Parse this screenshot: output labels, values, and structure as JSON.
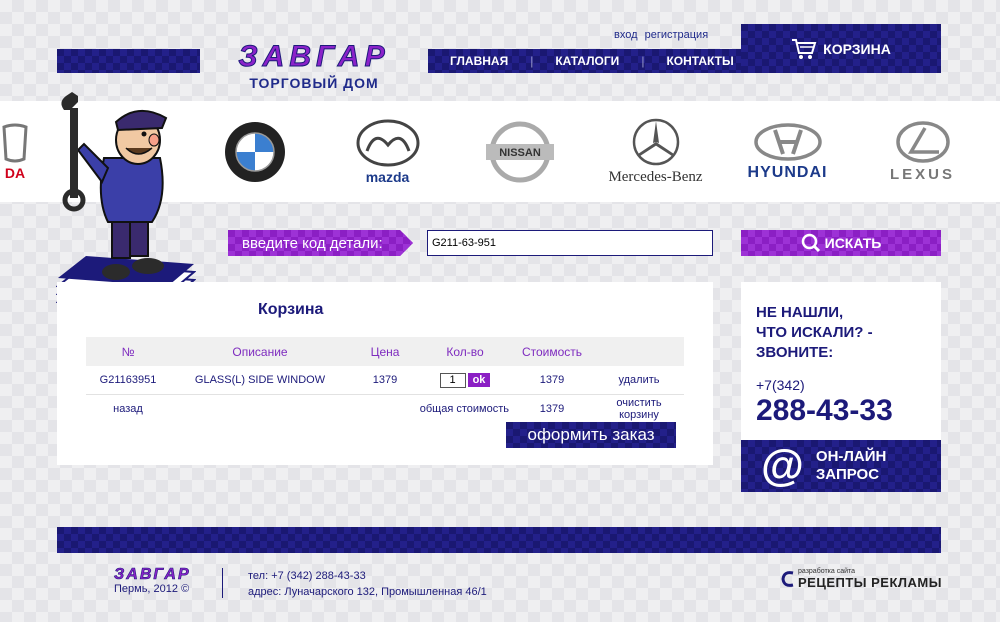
{
  "header": {
    "logo_title": "ЗАВГАР",
    "logo_subtitle": "ТОРГОВЫЙ ДОМ",
    "auth": {
      "login": "вход",
      "register": "регистрация"
    },
    "nav": [
      {
        "label": "ГЛАВНАЯ"
      },
      {
        "label": "КАТАЛОГИ"
      },
      {
        "label": "КОНТАКТЫ"
      }
    ],
    "cart_label": "КОРЗИНА"
  },
  "brands": [
    {
      "name": "Honda",
      "text": "DA"
    },
    {
      "name": "BMW",
      "text": ""
    },
    {
      "name": "Mazda",
      "text": "mazda"
    },
    {
      "name": "Nissan",
      "text": "NISSAN"
    },
    {
      "name": "Mercedes-Benz",
      "text": "Mercedes-Benz"
    },
    {
      "name": "Hyundai",
      "text": "HYUNDAI"
    },
    {
      "name": "Lexus",
      "text": "LEXUS"
    }
  ],
  "search": {
    "label": "введите код детали:",
    "value": "G211-63-951",
    "button": "ИСКАТЬ"
  },
  "cart": {
    "title": "Корзина",
    "columns": [
      "№",
      "Описание",
      "Цена",
      "Кол-во",
      "Стоимость",
      ""
    ],
    "rows": [
      {
        "num": "G21163951",
        "desc": "GLASS(L) SIDE WINDOW",
        "price": "1379",
        "qty": "1",
        "qty_ok": "ok",
        "total": "1379",
        "action": "удалить"
      }
    ],
    "back": "назад",
    "total_label": "общая стоимость",
    "total_value": "1379",
    "clear": "очистить корзину",
    "order_button": "оформить заказ"
  },
  "info": {
    "question_1": "НЕ НАШЛИ,",
    "question_2": "ЧТО ИСКАЛИ? -",
    "question_3": "ЗВОНИТЕ:",
    "phone_code": "+7(342)",
    "phone": "288-43-33",
    "online_1": "ОН-ЛАЙН",
    "online_2": "ЗАПРОС"
  },
  "footer": {
    "logo": "ЗАВГАР",
    "city": "Пермь, 2012 ©",
    "phone": "тел: +7 (342) 288-43-33",
    "address": "адрес: Луначарского 132, Промышленная 46/1",
    "dev_small": "разработка сайта",
    "dev_big": "РЕЦЕПТЫ РЕКЛАМЫ"
  },
  "colors": {
    "navy": "#1a1872",
    "purple": "#8b1fc4",
    "text": "#1c1a7a"
  }
}
